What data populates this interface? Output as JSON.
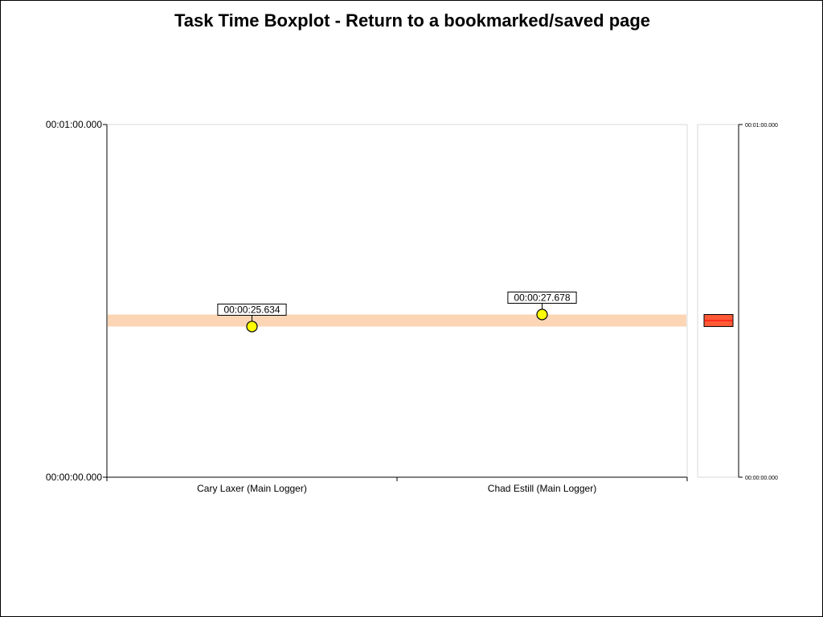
{
  "chart_data": {
    "type": "scatter",
    "title": "Task Time Boxplot - Return to a bookmarked/saved page",
    "categories": [
      "Cary Laxer (Main Logger)",
      "Chad Estill (Main Logger)"
    ],
    "values_seconds": [
      25.634,
      27.678
    ],
    "value_labels": [
      "00:00:25.634",
      "00:00:27.678"
    ],
    "ylim_seconds": [
      0,
      60
    ],
    "y_tick_values": [
      0,
      60
    ],
    "y_tick_labels": [
      "00:00:00.000",
      "00:01:00.000"
    ],
    "band_seconds": [
      25.634,
      27.678
    ],
    "box": {
      "min_seconds": 25.634,
      "max_seconds": 27.678,
      "median_seconds": 26.656,
      "y_tick_labels": [
        "00:00:00.000",
        "00:01:00.000"
      ]
    },
    "grid": false,
    "colors": {
      "marker_fill": "#ffff00",
      "marker_stroke": "#000000",
      "band": "#fcd5b4",
      "box_fill": "#ff5a36",
      "box_stroke": "#000000",
      "median_line": "#ff0000",
      "plot_border": "#d9d9d9",
      "axis": "#000000"
    }
  }
}
